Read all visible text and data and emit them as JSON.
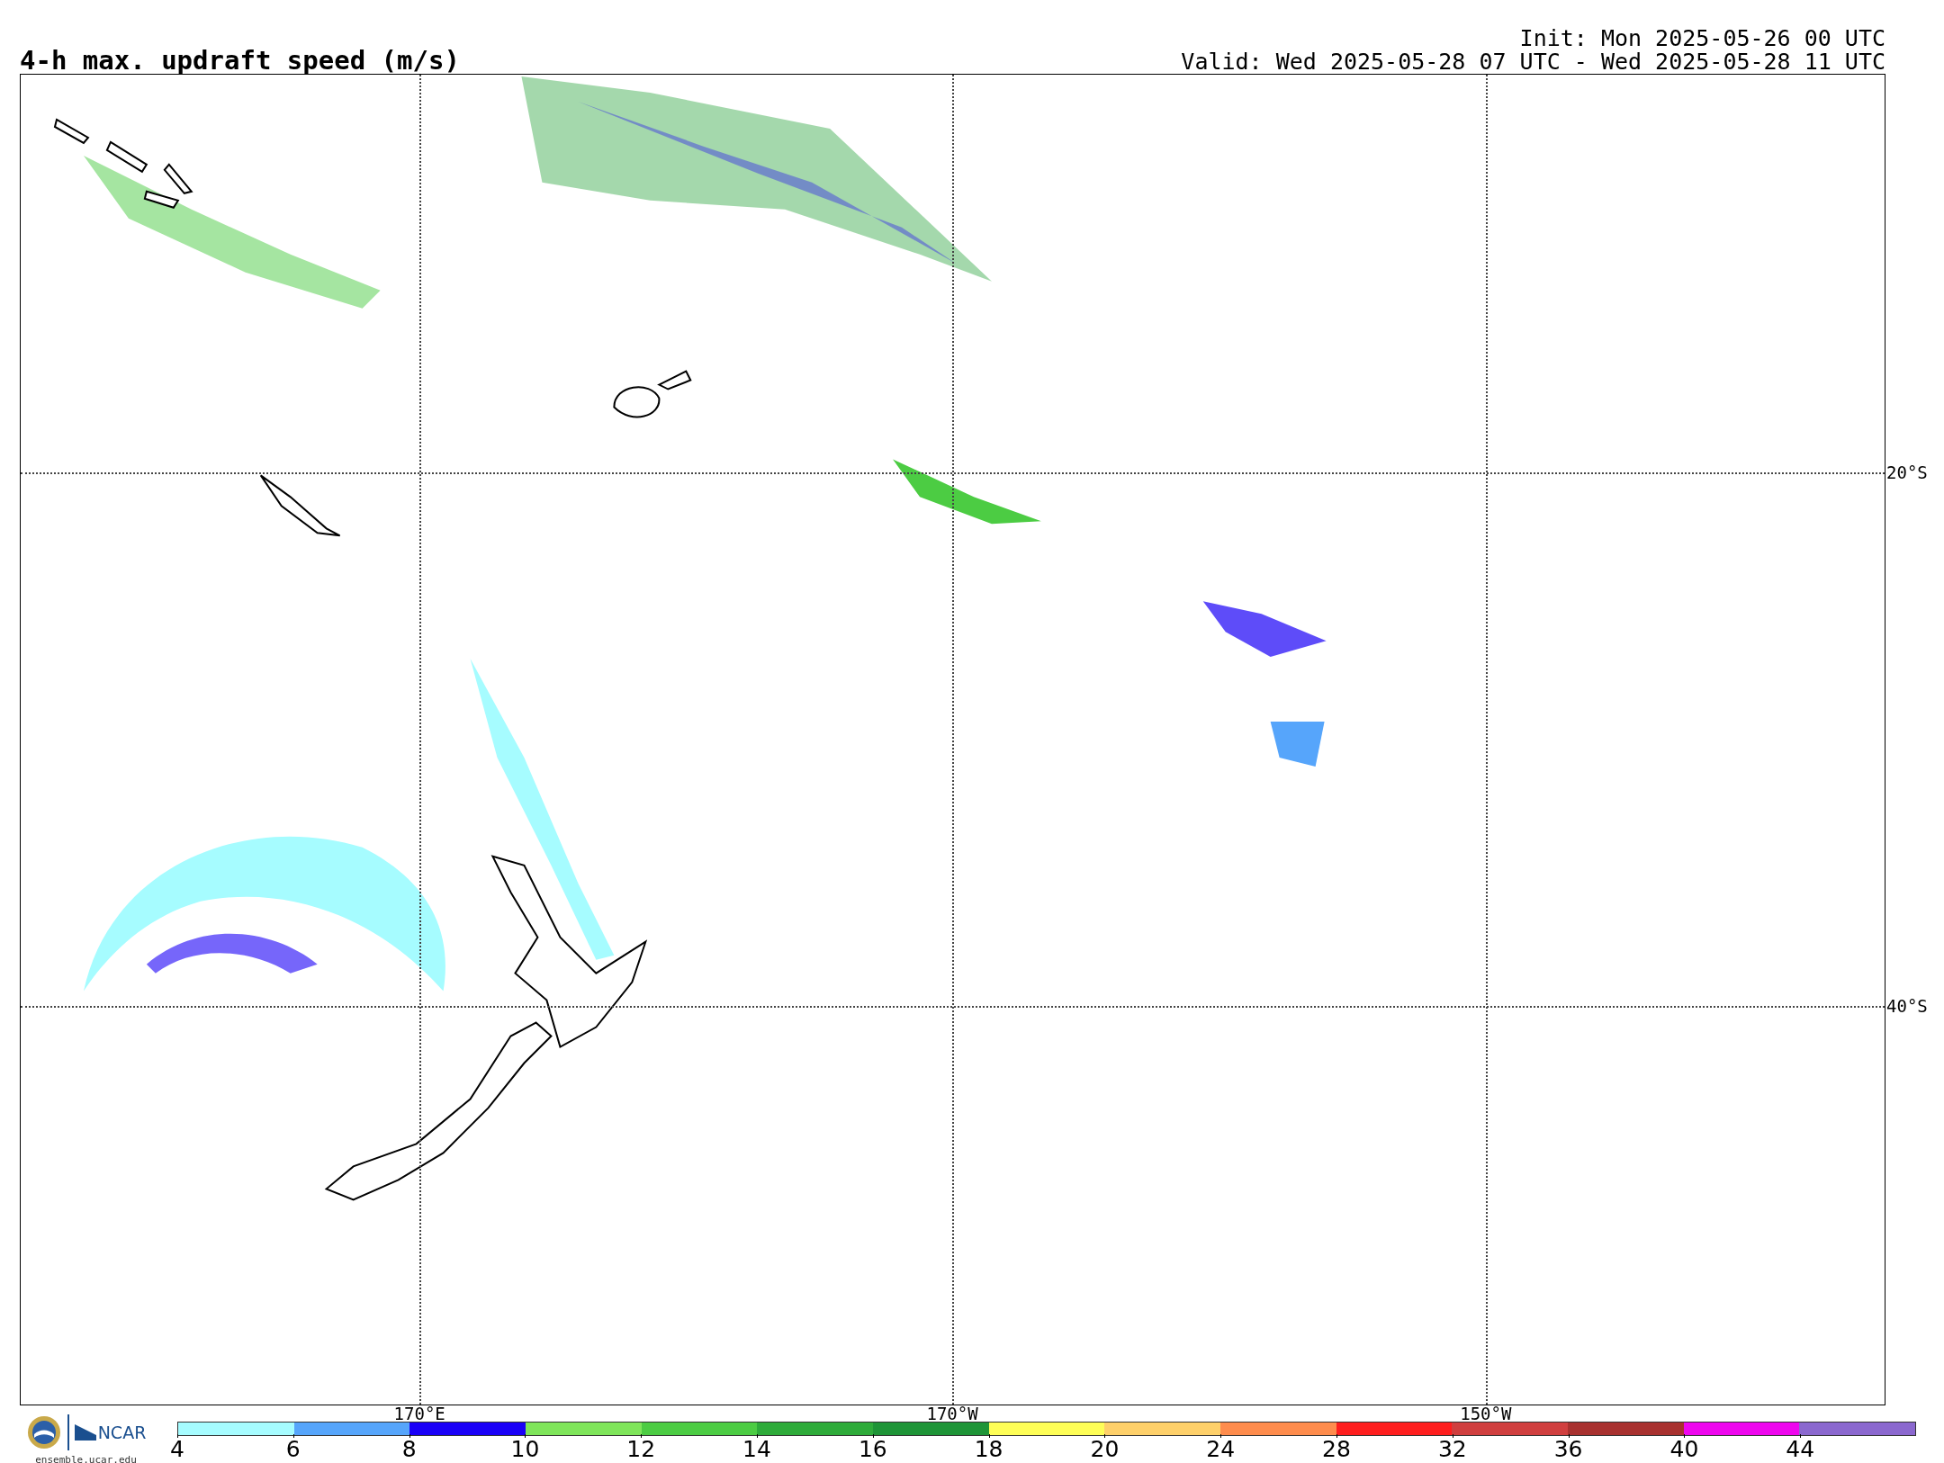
{
  "title": "4-h max. updraft speed (m/s)",
  "init": "Init: Mon 2025-05-26 00 UTC",
  "valid": "Valid: Wed 2025-05-28 07 UTC - Wed 2025-05-28 11 UTC",
  "map": {
    "lon_labels": [
      "170°E",
      "170°W",
      "150°W"
    ],
    "lat_labels": [
      "20°S",
      "40°S"
    ]
  },
  "logo": {
    "name": "NCAR",
    "url": "ensemble.ucar.edu"
  },
  "colorbar": {
    "segments": [
      {
        "color": "#a6fcff"
      },
      {
        "color": "#56a5fb"
      },
      {
        "color": "#1a00f7"
      },
      {
        "color": "#7fe55a"
      },
      {
        "color": "#4ccc43"
      },
      {
        "color": "#2eab3a"
      },
      {
        "color": "#1e9437"
      },
      {
        "color": "#fefe57"
      },
      {
        "color": "#fed06a"
      },
      {
        "color": "#fe8c4d"
      },
      {
        "color": "#fe1e1e"
      },
      {
        "color": "#d03f3f"
      },
      {
        "color": "#a8312f"
      },
      {
        "color": "#ee06ee"
      },
      {
        "color": "#8b68cf"
      }
    ],
    "ticks": [
      "4",
      "6",
      "8",
      "10",
      "12",
      "14",
      "16",
      "18",
      "20",
      "24",
      "28",
      "32",
      "36",
      "40",
      "44"
    ]
  }
}
